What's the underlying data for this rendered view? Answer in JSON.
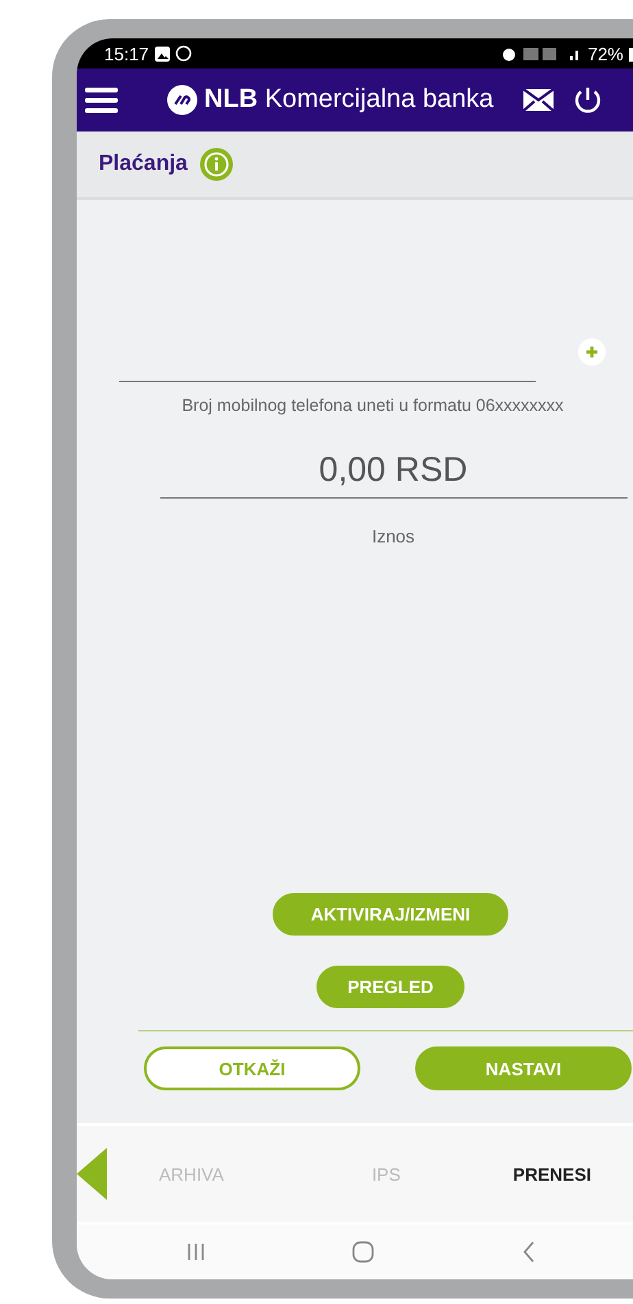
{
  "status_bar": {
    "time": "15:17",
    "battery": "72%"
  },
  "header": {
    "brand_bold": "NLB",
    "brand": "Komercijalna banka"
  },
  "section": {
    "title": "Plaćanja"
  },
  "form": {
    "phone_hint": "Broj mobilnog telefona uneti u formatu 06xxxxxxxx",
    "amount": "0,00 RSD",
    "amount_label": "Iznos"
  },
  "actions": [
    {
      "label": "AKTIVIRAJ/IZMENI"
    },
    {
      "label": "PREGLED"
    }
  ],
  "footer_buttons": [
    {
      "label": "OTKAŽI",
      "kind": "outline"
    },
    {
      "label": "NASTAVI",
      "kind": "filled"
    }
  ],
  "tabs": [
    {
      "label": "ARHIVA",
      "selected": false
    },
    {
      "label": "IPS",
      "selected": false
    },
    {
      "label": "PRENESI",
      "selected": true
    }
  ]
}
